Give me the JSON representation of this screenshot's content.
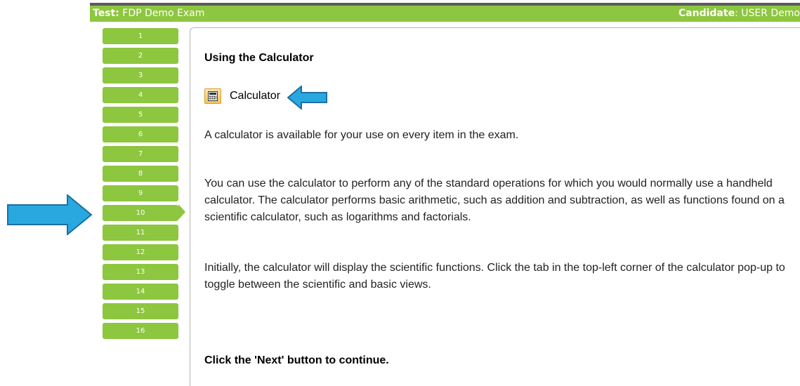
{
  "header": {
    "test_label": "Test:",
    "test_name": " FDP Demo Exam",
    "candidate_label": "Candidate",
    "candidate_name": ": USER Demo"
  },
  "nav": {
    "items": [
      "1",
      "2",
      "3",
      "4",
      "5",
      "6",
      "7",
      "8",
      "9",
      "10",
      "11",
      "12",
      "13",
      "14",
      "15",
      "16"
    ],
    "current": "10"
  },
  "content": {
    "title": "Using the Calculator",
    "calculator_label": "Calculator",
    "paragraph1": "A calculator is available for your use on every item in the exam.",
    "paragraph2": "You can use the calculator to perform any of the standard operations for which you would normally use a handheld calculator. The calculator performs basic arithmetic, such as addition and subtraction, as well as functions found on a scientific calculator, such as logarithms and factorials.",
    "paragraph3": "Initially, the calculator will display the scientific functions. Click the tab in the top-left corner of the calculator pop-up to toggle between the scientific and basic views.",
    "footer": "Click the 'Next' button to continue."
  },
  "colors": {
    "accent_green": "#8dc63f",
    "arrow_blue": "#29a8e0",
    "arrow_blue_dark": "#1c6fa3"
  },
  "icons": {
    "calculator_button": "calculator-icon",
    "annotation_arrow_right": "arrow-right-icon",
    "annotation_arrow_left": "arrow-left-icon"
  }
}
